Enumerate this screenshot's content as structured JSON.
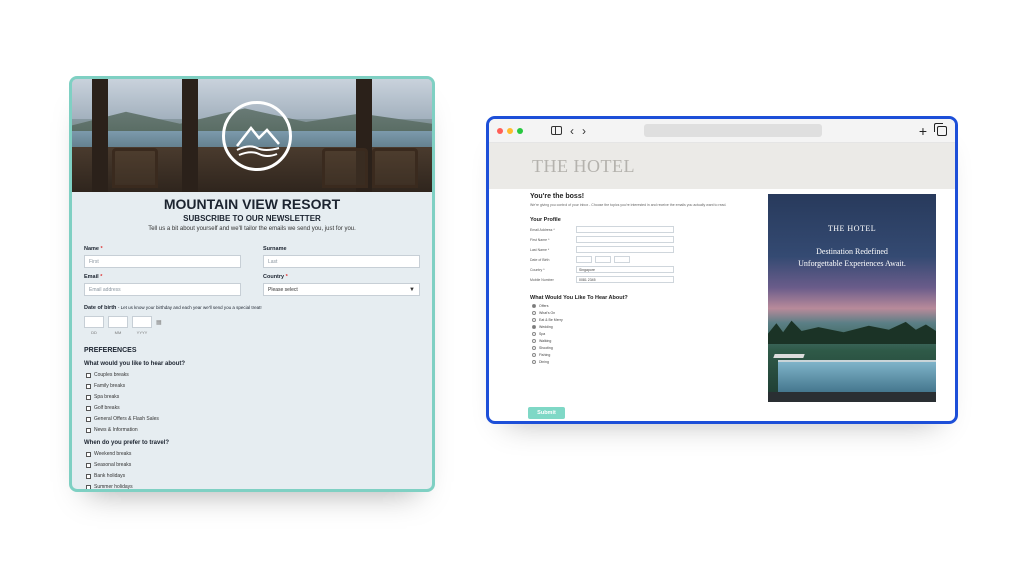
{
  "mountain_view": {
    "title": "MOUNTAIN VIEW RESORT",
    "subtitle": "SUBSCRIBE TO OUR NEWSLETTER",
    "tagline": "Tell us a bit about yourself and we'll tailor the emails we send you, just for you.",
    "name_label": "Name",
    "name_placeholder": "First",
    "surname_label": "Surname",
    "surname_placeholder": "Last",
    "email_label": "Email",
    "email_placeholder": "Email address",
    "country_label": "Country",
    "country_value": "Please select",
    "dob_label": "Date of birth",
    "dob_hint": "- Let us know your birthday and each year we'll send you a special treat!",
    "dob_parts": [
      "DD",
      "MM",
      "YYYY"
    ],
    "preferences_heading": "PREFERENCES",
    "hear_question": "What would you like to hear about?",
    "hear_options": [
      "Couples breaks",
      "Family breaks",
      "Spa breaks",
      "Golf breaks",
      "General Offers & Flash Sales",
      "News & Information"
    ],
    "travel_question": "When do you prefer to travel?",
    "travel_options": [
      "Weekend breaks",
      "Seasonal breaks",
      "Bank holidays",
      "Summer holidays"
    ],
    "required_mark": "*"
  },
  "hotel": {
    "brand": "THE HOTEL",
    "heading": "You're the boss!",
    "intro": "We're giving you control of your inbox - Choose the topics you're interested in and receive the emails you actually want to read.",
    "profile_heading": "Your Profile",
    "profile_fields": [
      {
        "label": "Email Address *",
        "value": ""
      },
      {
        "label": "First Name *",
        "value": ""
      },
      {
        "label": "Last Name *",
        "value": ""
      }
    ],
    "dob_label": "Date of Birth",
    "country_label": "Country *",
    "country_value": "Singapore",
    "mobile_label": "Mobile Number",
    "mobile_value": "0081 2345",
    "hear_heading": "What Would You Like To Hear About?",
    "hear_options": [
      {
        "label": "Offers",
        "selected": true
      },
      {
        "label": "What's On",
        "selected": false
      },
      {
        "label": "Eat & Be Merry",
        "selected": false
      },
      {
        "label": "Wedding",
        "selected": true
      },
      {
        "label": "Spa",
        "selected": false
      },
      {
        "label": "Walking",
        "selected": false
      },
      {
        "label": "Shooting",
        "selected": false
      },
      {
        "label": "Fishing",
        "selected": false
      },
      {
        "label": "Dining",
        "selected": false
      }
    ],
    "submit_label": "Submit",
    "promo_brand": "THE HOTEL",
    "promo_line1": "Destination Redefined",
    "promo_line2": "Unforgettable Experiences Await."
  },
  "browser": {
    "traffic_colors": [
      "#ff5f57",
      "#febc2e",
      "#28c840"
    ],
    "back_glyph": "‹",
    "forward_glyph": "›",
    "new_tab_glyph": "+"
  }
}
